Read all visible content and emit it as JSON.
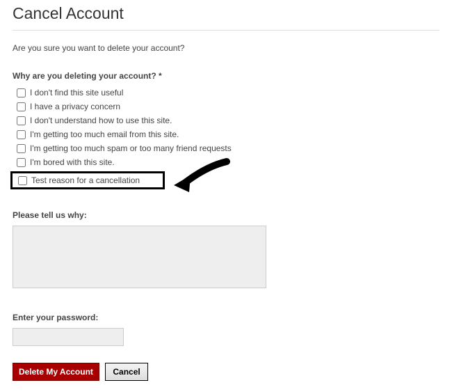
{
  "page": {
    "title": "Cancel Account",
    "confirm_text": "Are you sure you want to delete your account?"
  },
  "question": {
    "label": "Why are you deleting your account? *",
    "options": [
      "I don't find this site useful",
      "I have a privacy concern",
      "I don't understand how to use this site.",
      "I'm getting too much email from this site.",
      "I'm getting too much spam or too many friend requests",
      "I'm bored with this site.",
      "Test reason for a cancellation"
    ]
  },
  "comment": {
    "label": "Please tell us why:",
    "value": ""
  },
  "password": {
    "label": "Enter your password:",
    "value": ""
  },
  "buttons": {
    "delete": "Delete My Account",
    "cancel": "Cancel"
  }
}
